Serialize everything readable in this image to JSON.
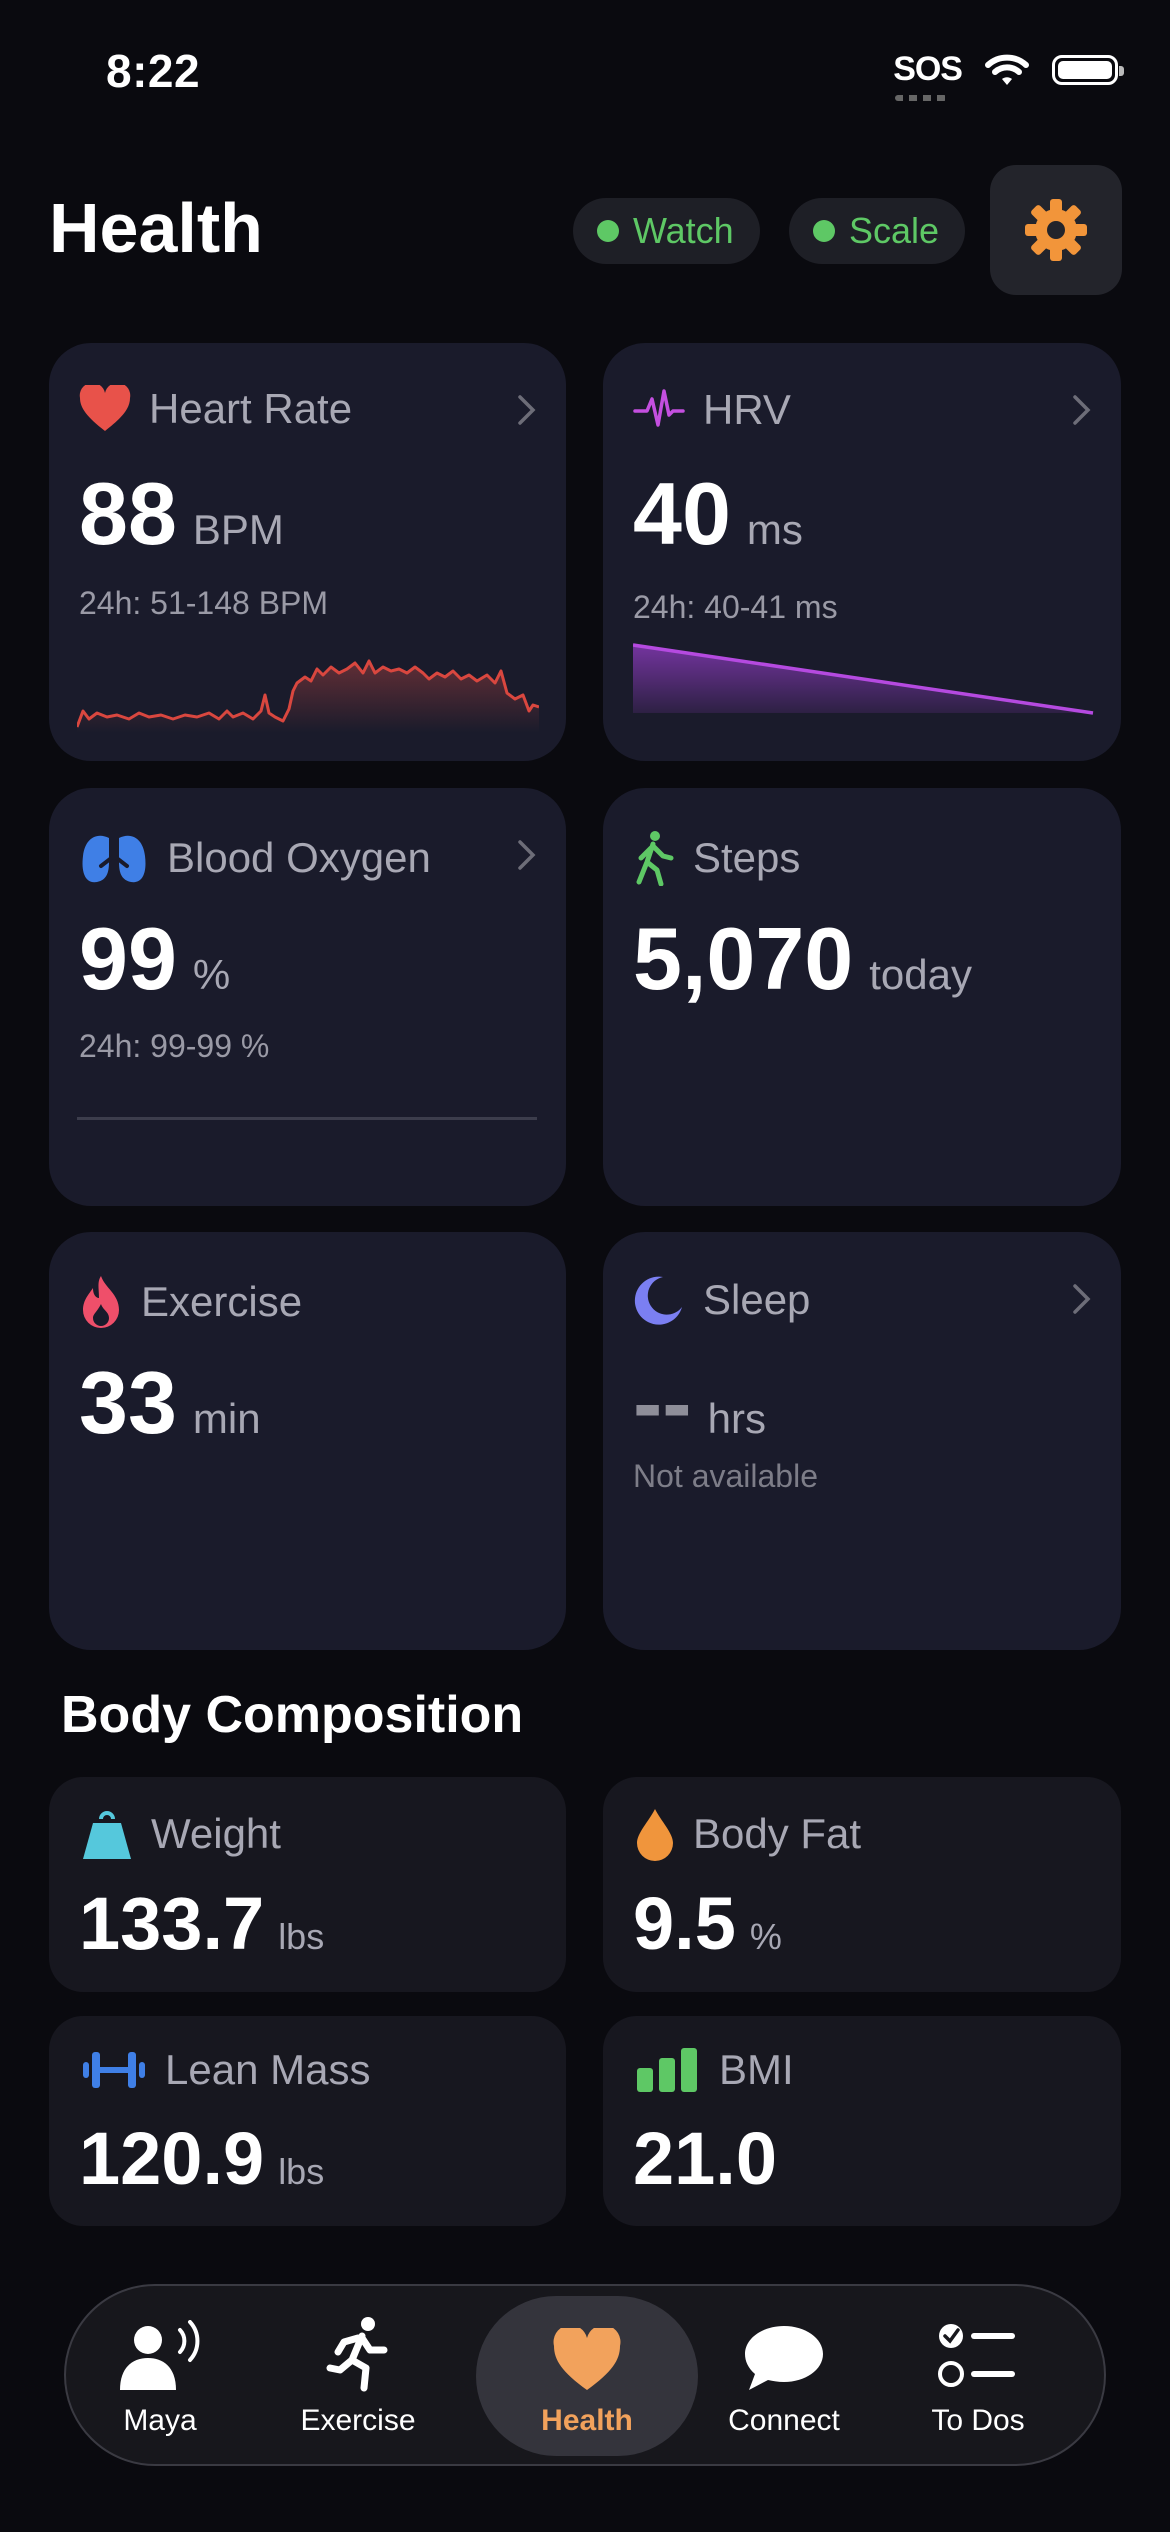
{
  "status_bar": {
    "time": "8:22",
    "sos": "SOS"
  },
  "header": {
    "title": "Health",
    "devices": [
      {
        "label": "Watch",
        "status_color": "#5ec865"
      },
      {
        "label": "Scale",
        "status_color": "#5ec865"
      }
    ],
    "settings_icon": "gear-icon"
  },
  "metrics": {
    "heart_rate": {
      "label": "Heart Rate",
      "value": "88",
      "unit": "BPM",
      "range": "24h: 51-148 BPM",
      "icon": "heart-icon",
      "color": "#e8524a"
    },
    "hrv": {
      "label": "HRV",
      "value": "40",
      "unit": "ms",
      "range": "24h: 40-41 ms",
      "icon": "pulse-icon",
      "color": "#c44fe0"
    },
    "blood_oxygen": {
      "label": "Blood Oxygen",
      "value": "99",
      "unit": "%",
      "range": "24h: 99-99 %",
      "icon": "lungs-icon",
      "color": "#3f7fe6"
    },
    "steps": {
      "label": "Steps",
      "value": "5,070",
      "unit": "today",
      "icon": "walking-icon",
      "color": "#5ec865"
    },
    "exercise": {
      "label": "Exercise",
      "value": "33",
      "unit": "min",
      "icon": "flame-icon",
      "color": "#ef4f6a"
    },
    "sleep": {
      "label": "Sleep",
      "value": "--",
      "unit": "hrs",
      "status": "Not available",
      "icon": "moon-icon",
      "color": "#7b7ff2"
    }
  },
  "body_composition": {
    "title": "Body Composition",
    "weight": {
      "label": "Weight",
      "value": "133.7",
      "unit": "lbs",
      "icon": "scale-weight-icon",
      "color": "#55c8dc"
    },
    "body_fat": {
      "label": "Body Fat",
      "value": "9.5",
      "unit": "%",
      "icon": "drop-icon",
      "color": "#f0953c"
    },
    "lean_mass": {
      "label": "Lean Mass",
      "value": "120.9",
      "unit": "lbs",
      "icon": "dumbbell-icon",
      "color": "#3f7fe6"
    },
    "bmi": {
      "label": "BMI",
      "value": "21.0",
      "icon": "bar-chart-icon",
      "color": "#5ec865"
    }
  },
  "tab_bar": {
    "active": "Health",
    "tabs": [
      {
        "label": "Maya",
        "icon": "speaking-person-icon"
      },
      {
        "label": "Exercise",
        "icon": "running-icon"
      },
      {
        "label": "Health",
        "icon": "heart-icon"
      },
      {
        "label": "Connect",
        "icon": "chat-bubble-icon"
      },
      {
        "label": "To Dos",
        "icon": "checklist-icon"
      }
    ]
  }
}
